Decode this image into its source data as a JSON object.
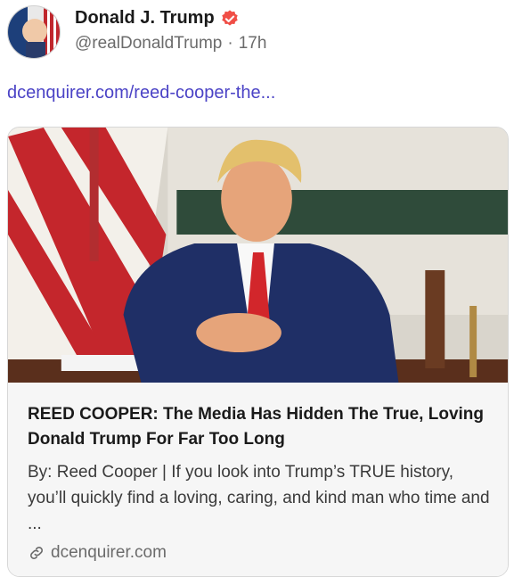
{
  "post": {
    "author_name": "Donald J. Trump",
    "handle": "@realDonaldTrump",
    "separator": "·",
    "time": "17h",
    "link_text": "dcenquirer.com/reed-cooper-the..."
  },
  "card": {
    "title": "REED COOPER: The Media Has Hidden The True, Loving Donald Trump For Far Too Long",
    "description": "By: Reed Cooper | If you look into Trump’s TRUE history, you’ll quickly find a loving, caring, and kind man who time and ...",
    "domain": "dcenquirer.com"
  },
  "colors": {
    "link": "#4b43c6",
    "verified_badge": "#f04e46"
  },
  "icons": {
    "verified": "verified-badge-icon",
    "link": "link-chain-icon"
  }
}
